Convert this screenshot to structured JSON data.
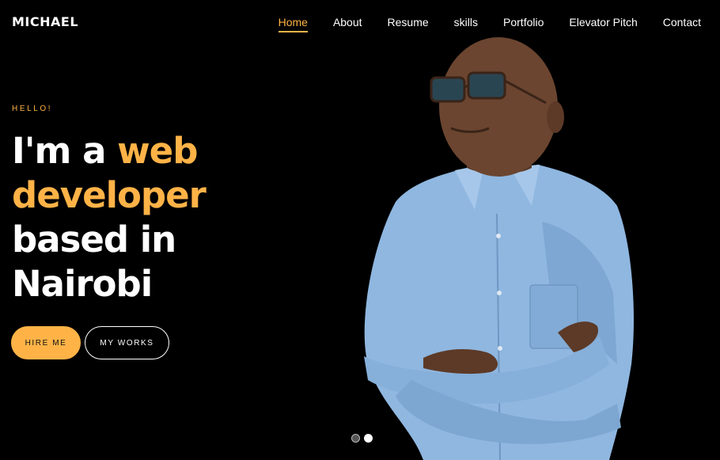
{
  "brand": {
    "name": "MICHAEL"
  },
  "nav": {
    "items": [
      {
        "label": "Home",
        "active": true
      },
      {
        "label": "About",
        "active": false
      },
      {
        "label": "Resume",
        "active": false
      },
      {
        "label": "skills",
        "active": false
      },
      {
        "label": "Portfolio",
        "active": false
      },
      {
        "label": "Elevator Pitch",
        "active": false
      },
      {
        "label": "Contact",
        "active": false
      }
    ]
  },
  "hero": {
    "kicker": "HELLO!",
    "headline_part1": "I'm a ",
    "headline_accent": "web developer",
    "headline_part2": " based in Nairobi",
    "primary_button": "HIRE ME",
    "secondary_button": "MY WORKS"
  },
  "slider": {
    "slide_count": 2,
    "active_index": 1
  },
  "colors": {
    "accent": "#ffb347",
    "background": "#000000",
    "shirt": "#8fb7e0",
    "skin": "#6b4530"
  },
  "icons": [
    "portrait-photo"
  ]
}
